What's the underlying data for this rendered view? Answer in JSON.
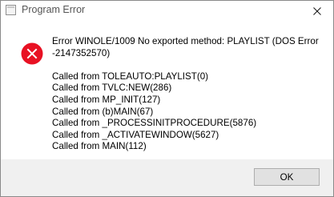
{
  "window": {
    "title": "Program Error",
    "title_icon": "app-window-icon",
    "close_icon": "close-icon"
  },
  "error": {
    "icon": "error-circle-x-icon",
    "icon_color": "#e81123",
    "lines": [
      "Error WINOLE/1009  No exported method: PLAYLIST (DOS Error",
      "-2147352570)"
    ],
    "call_stack": [
      "Called from TOLEAUTO:PLAYLIST(0)",
      "Called from TVLC:NEW(286)",
      "Called from MP_INIT(127)",
      "Called from (b)MAIN(67)",
      "Called from _PROCESSINITPROCEDURE(5876)",
      "Called from _ACTIVATEWINDOW(5627)",
      "Called from MAIN(112)"
    ]
  },
  "buttons": {
    "ok_label": "OK"
  }
}
